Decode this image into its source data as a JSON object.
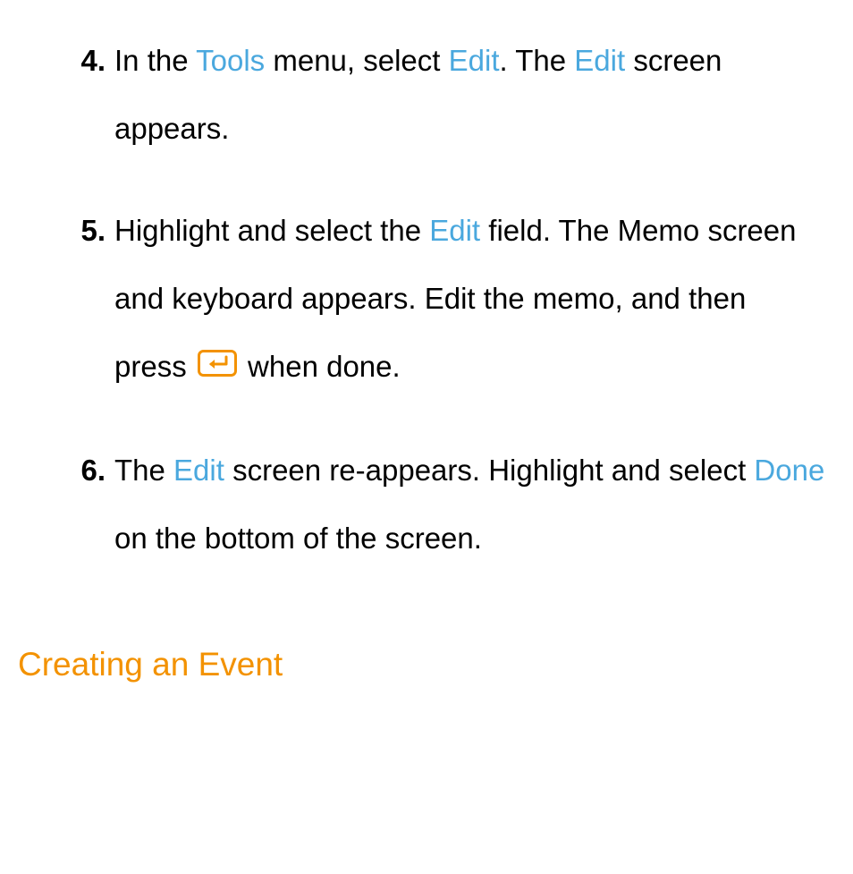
{
  "steps": [
    {
      "number": "4.",
      "segments": [
        {
          "t": "text",
          "v": "In the "
        },
        {
          "t": "term",
          "v": "Tools"
        },
        {
          "t": "text",
          "v": " menu, select "
        },
        {
          "t": "term",
          "v": "Edit"
        },
        {
          "t": "text",
          "v": ". The "
        },
        {
          "t": "term",
          "v": "Edit"
        },
        {
          "t": "text",
          "v": " screen appears."
        }
      ]
    },
    {
      "number": "5.",
      "segments": [
        {
          "t": "text",
          "v": "Highlight and select the "
        },
        {
          "t": "term",
          "v": "Edit"
        },
        {
          "t": "text",
          "v": " field. The Memo screen and keyboard appears. Edit the memo, and then press "
        },
        {
          "t": "icon",
          "name": "enter-icon"
        },
        {
          "t": "text",
          "v": " when done."
        }
      ]
    },
    {
      "number": "6.",
      "segments": [
        {
          "t": "text",
          "v": "The "
        },
        {
          "t": "term",
          "v": "Edit"
        },
        {
          "t": "text",
          "v": " screen re-appears. Highlight and select "
        },
        {
          "t": "term",
          "v": "Done"
        },
        {
          "t": "text",
          "v": " on the bottom of the screen."
        }
      ]
    }
  ],
  "heading": "Creating an Event",
  "icon_color": "#f39200"
}
